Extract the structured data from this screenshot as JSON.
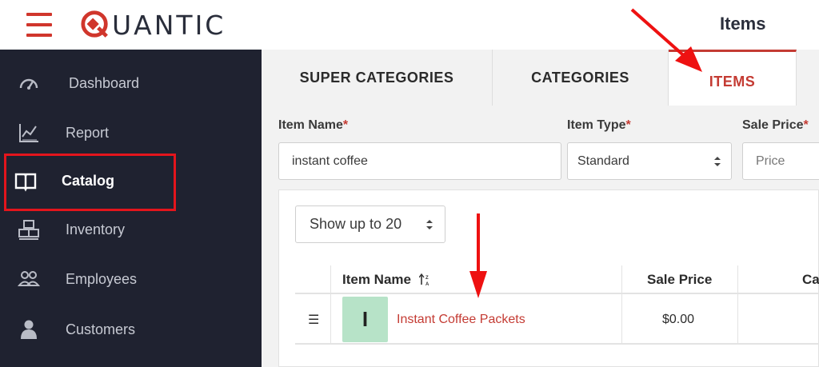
{
  "header": {
    "brand": "UANTIC",
    "page_title": "Items"
  },
  "sidebar": {
    "items": [
      {
        "label": "Dashboard",
        "icon": "gauge-icon"
      },
      {
        "label": "Report",
        "icon": "line-chart-icon"
      },
      {
        "label": "Catalog",
        "icon": "open-book-icon",
        "active": true
      },
      {
        "label": "Inventory",
        "icon": "boxes-icon"
      },
      {
        "label": "Employees",
        "icon": "group-icon"
      },
      {
        "label": "Customers",
        "icon": "person-icon"
      }
    ]
  },
  "tabs": [
    {
      "label": "SUPER CATEGORIES"
    },
    {
      "label": "CATEGORIES"
    },
    {
      "label": "ITEMS",
      "active": true
    }
  ],
  "form": {
    "item_name_label": "Item Name",
    "item_name_value": "instant coffee",
    "item_type_label": "Item Type",
    "item_type_value": "Standard",
    "sale_price_label": "Sale Price",
    "sale_price_placeholder": "Price",
    "required_mark": "*"
  },
  "list": {
    "page_size_label": "Show up to 20",
    "columns": [
      "Item Name",
      "Sale Price",
      "Ca"
    ],
    "sort_icon": "sort-alpha-icon",
    "rows": [
      {
        "drag_icon": "☰",
        "thumb_letter": "I",
        "name": "Instant Coffee Packets",
        "sale_price": "$0.00"
      }
    ]
  },
  "colors": {
    "brand_red": "#d0362c",
    "sidebar_bg": "#1f2230",
    "accent": "#c43b33",
    "highlight_box": "#e3151c",
    "thumb_bg": "#b7e3c8"
  }
}
